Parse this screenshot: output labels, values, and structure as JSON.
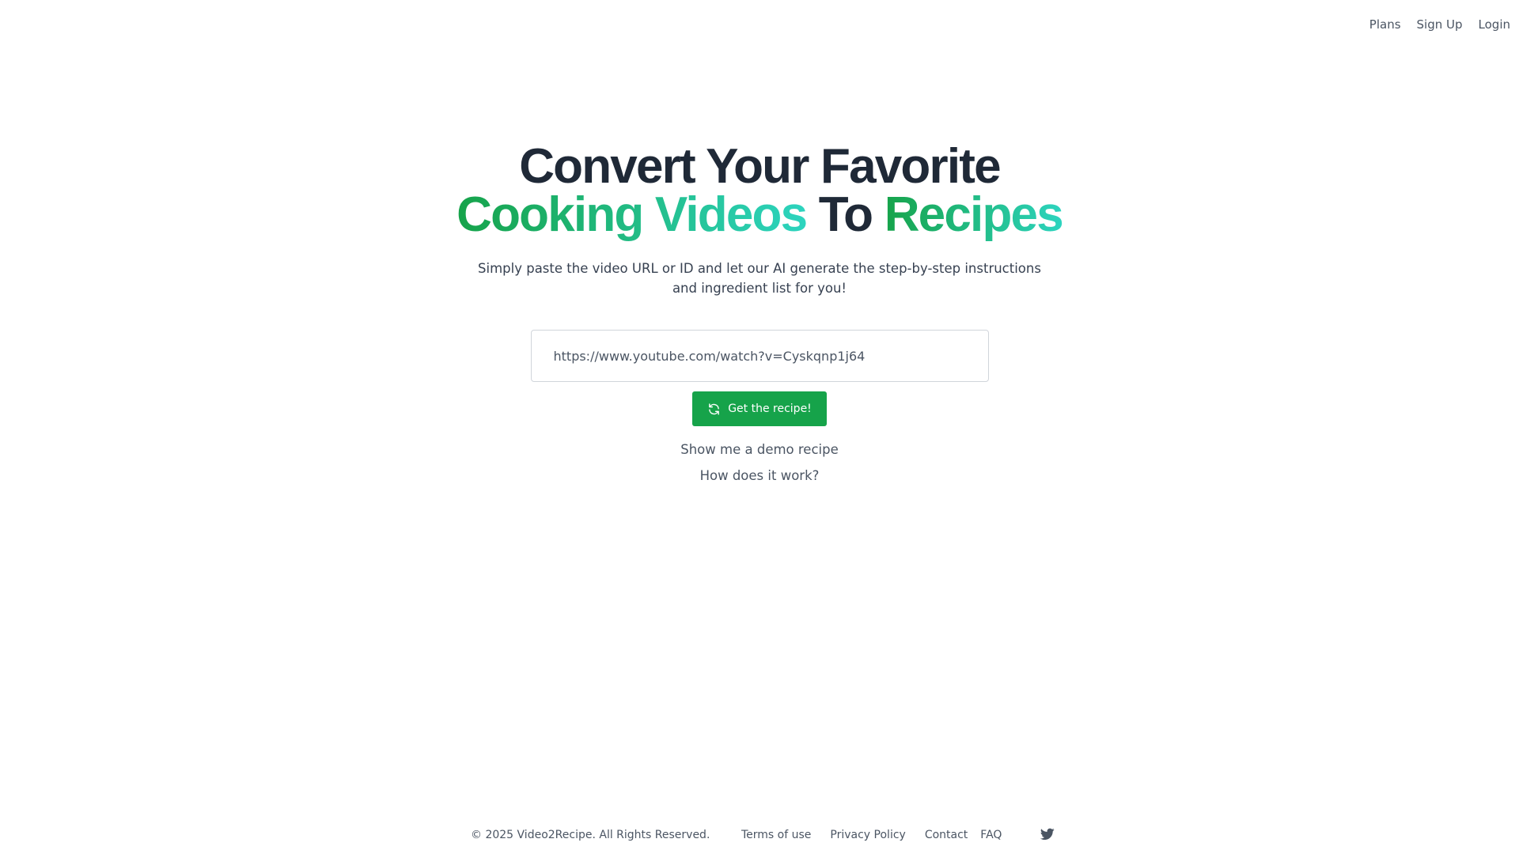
{
  "nav": {
    "plans": "Plans",
    "signup": "Sign Up",
    "login": "Login"
  },
  "hero": {
    "line1": "Convert Your Favorite",
    "line2_a": "Cooking Videos",
    "line2_b": "To",
    "line2_c": "Recipes",
    "subtitle": "Simply paste the video URL or ID and let our AI generate the step-by-step instructions and ingredient list for you!",
    "input_value": "https://www.youtube.com/watch?v=Cyskqnp1j64",
    "button_label": "Get the recipe!",
    "demo_link": "Show me a demo recipe",
    "how_link": "How does it work?"
  },
  "footer": {
    "copyright": "© 2025 Video2Recipe. All Rights Reserved.",
    "links": [
      "Terms of use",
      "Privacy Policy",
      "Contact",
      "FAQ"
    ],
    "social_icon": "twitter-icon"
  },
  "colors": {
    "accent_green": "#16a34a",
    "gradient_end": "#2dd4bf",
    "heading": "#1f2937"
  }
}
